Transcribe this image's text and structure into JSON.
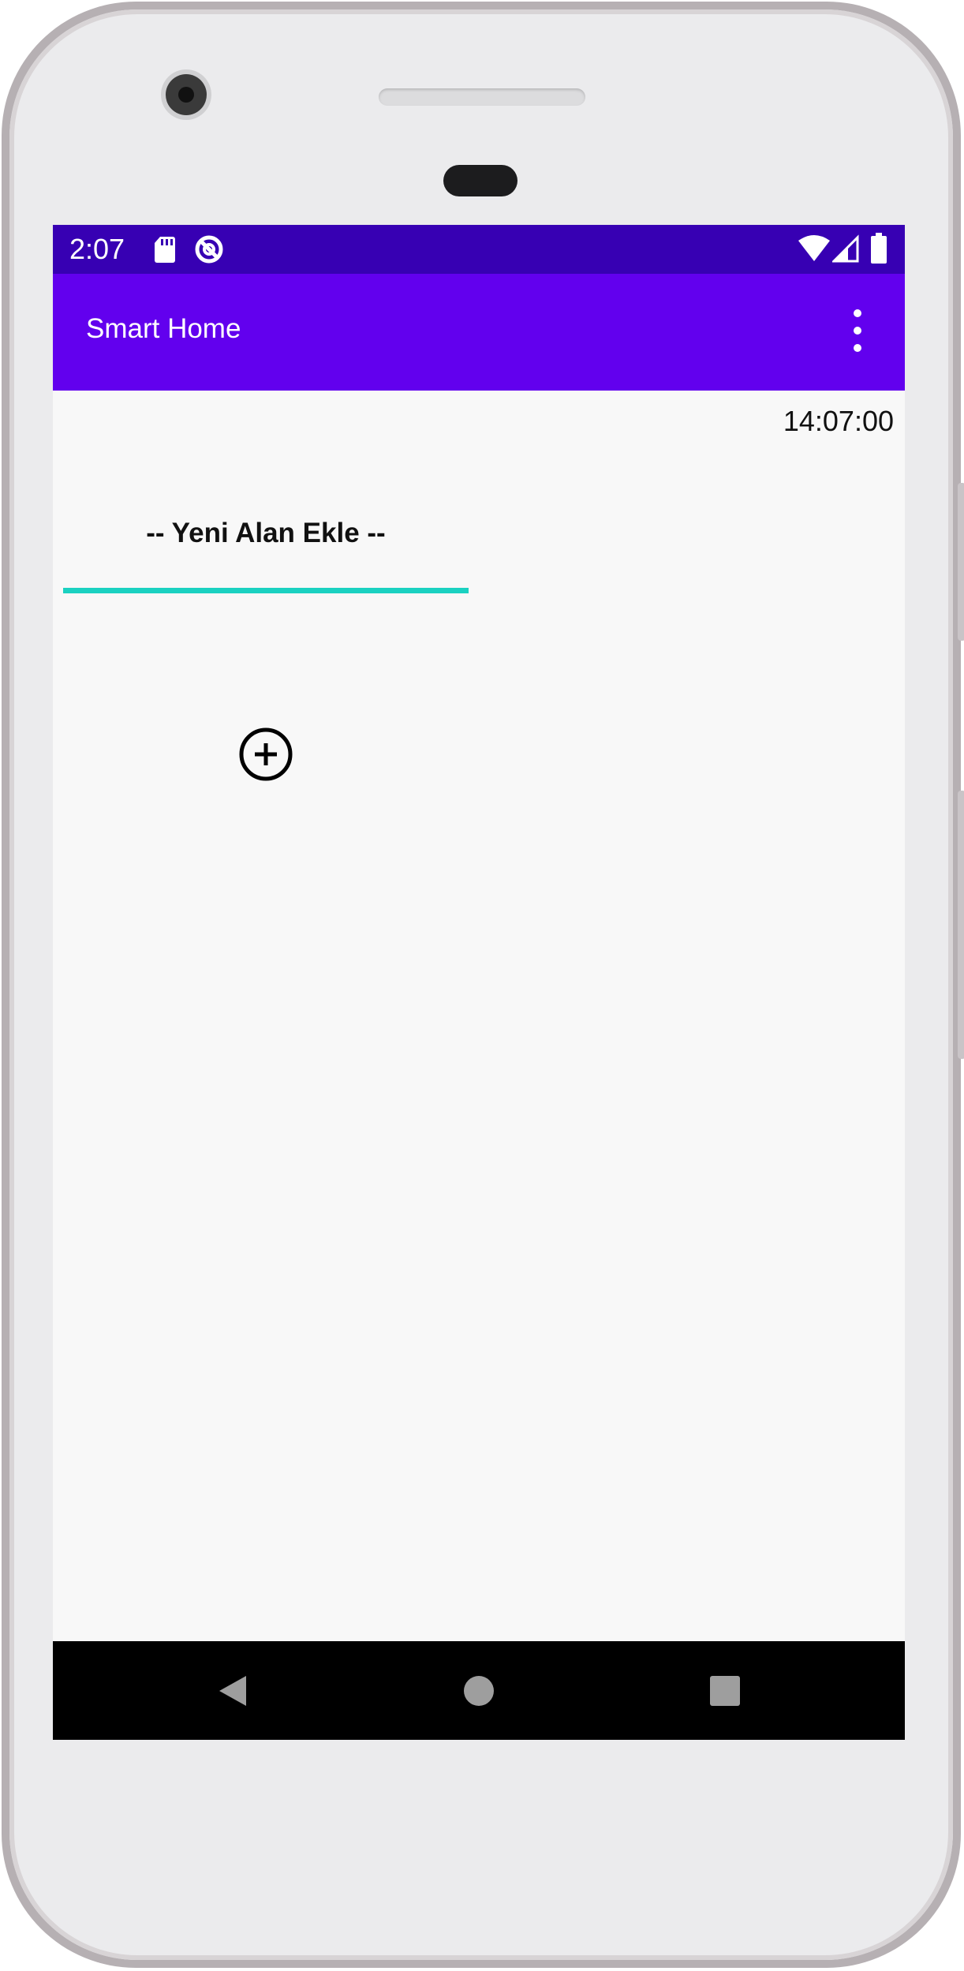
{
  "status_bar": {
    "time": "2:07",
    "icons": [
      "sd-card-icon",
      "data-saver-icon",
      "wifi-icon",
      "cell-signal-icon",
      "battery-icon"
    ]
  },
  "app_bar": {
    "title": "Smart Home",
    "menu_icon": "more-vert-icon"
  },
  "main": {
    "clock": "14:07:00",
    "area_spinner": {
      "selected": "-- Yeni Alan Ekle --"
    },
    "add_button_icon": "add-circle-icon"
  },
  "nav_bar": {
    "icons": [
      "back-icon",
      "home-icon",
      "recents-icon"
    ]
  },
  "colors": {
    "status_bar": "#3700b3",
    "app_bar": "#6200ee",
    "spinner_underline": "#1bd1c1",
    "screen_bg": "#f8f8f8"
  }
}
